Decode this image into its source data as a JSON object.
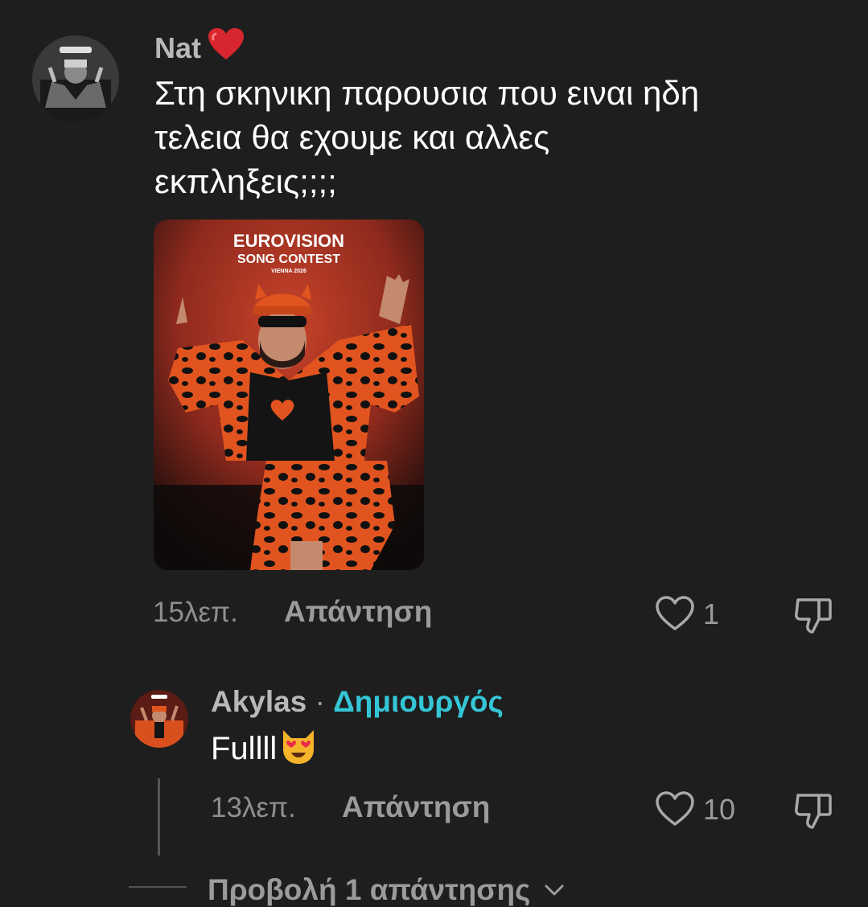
{
  "comment": {
    "username": "Nat",
    "username_emoji": "heart",
    "text_lines": [
      "Στη σκηνικη παρουσια που ειναι ηδη",
      "τελεια θα εχουμε και αλλες",
      "εκπληξεις;;;;"
    ],
    "image": {
      "logo_line1": "EUROVISION",
      "logo_line2": "SONG CONTEST",
      "logo_line3": "VIENNA 2026"
    },
    "time": "15λεπ.",
    "reply_label": "Απάντηση",
    "like_count": "1"
  },
  "reply": {
    "username": "Akylas",
    "separator": "·",
    "badge": "Δημιουργός",
    "text": "Fullll",
    "text_emoji": "heart-eyes-cat",
    "time": "13λεπ.",
    "reply_label": "Απάντηση",
    "like_count": "10"
  },
  "view_replies": {
    "label": "Προβολή 1 απάντησης"
  },
  "colors": {
    "background": "#1e1e1e",
    "creator_badge": "#35c6d6",
    "heart": "#d7262d"
  }
}
